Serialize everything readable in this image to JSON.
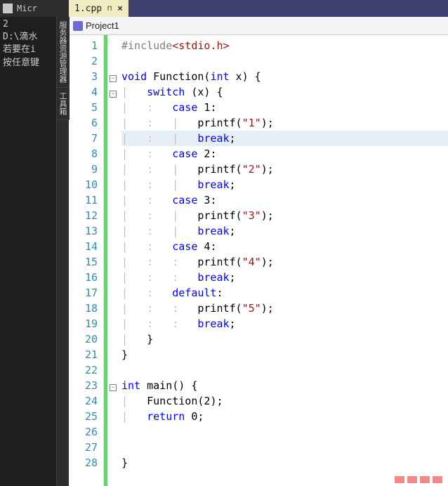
{
  "iconStrip": {
    "title": "Micr"
  },
  "tab": {
    "filename": "1.cpp",
    "close": "×"
  },
  "sidePanel": {
    "lines": [
      "2",
      "D:\\滴水",
      "若要在i",
      "按任意键"
    ],
    "vtabs": [
      "服务器资源管理器",
      "工具箱"
    ]
  },
  "scope": {
    "project": "Project1"
  },
  "code": {
    "lines": [
      {
        "n": 1,
        "fold": "",
        "tokens": [
          [
            "pre",
            "#include"
          ],
          [
            "inc",
            "<stdio.h>"
          ]
        ],
        "indent": 0
      },
      {
        "n": 2,
        "fold": "",
        "tokens": [],
        "indent": 0
      },
      {
        "n": 3,
        "fold": "-",
        "tokens": [
          [
            "kw",
            "void"
          ],
          [
            "ident",
            " Function("
          ],
          [
            "kw",
            "int"
          ],
          [
            "ident",
            " x) {"
          ]
        ],
        "indent": 0
      },
      {
        "n": 4,
        "fold": "-",
        "tokens": [
          [
            "g",
            "|   "
          ],
          [
            "ctrl",
            "switch"
          ],
          [
            "ident",
            " (x) {"
          ]
        ],
        "indent": 0
      },
      {
        "n": 5,
        "fold": "",
        "tokens": [
          [
            "g",
            "|   :   "
          ],
          [
            "ctrl",
            "case"
          ],
          [
            "ident",
            " "
          ],
          [
            "num",
            "1"
          ],
          [
            "ident",
            ":"
          ]
        ],
        "indent": 0
      },
      {
        "n": 6,
        "fold": "",
        "tokens": [
          [
            "g",
            "|   :   |   "
          ],
          [
            "ident",
            "printf("
          ],
          [
            "str",
            "\"1\""
          ],
          [
            "ident",
            ");"
          ]
        ],
        "indent": 0
      },
      {
        "n": 7,
        "fold": "",
        "hl": true,
        "tokens": [
          [
            "g",
            "|   :   |   "
          ],
          [
            "ctrl",
            "break"
          ],
          [
            "ident",
            ";"
          ]
        ],
        "indent": 0
      },
      {
        "n": 8,
        "fold": "",
        "tokens": [
          [
            "g",
            "|   :   "
          ],
          [
            "ctrl",
            "case"
          ],
          [
            "ident",
            " "
          ],
          [
            "num",
            "2"
          ],
          [
            "ident",
            ":"
          ]
        ],
        "indent": 0
      },
      {
        "n": 9,
        "fold": "",
        "tokens": [
          [
            "g",
            "|   :   |   "
          ],
          [
            "ident",
            "printf("
          ],
          [
            "str",
            "\"2\""
          ],
          [
            "ident",
            ");"
          ]
        ],
        "indent": 0
      },
      {
        "n": 10,
        "fold": "",
        "tokens": [
          [
            "g",
            "|   :   |   "
          ],
          [
            "ctrl",
            "break"
          ],
          [
            "ident",
            ";"
          ]
        ],
        "indent": 0
      },
      {
        "n": 11,
        "fold": "",
        "tokens": [
          [
            "g",
            "|   :   "
          ],
          [
            "ctrl",
            "case"
          ],
          [
            "ident",
            " "
          ],
          [
            "num",
            "3"
          ],
          [
            "ident",
            ":"
          ]
        ],
        "indent": 0
      },
      {
        "n": 12,
        "fold": "",
        "tokens": [
          [
            "g",
            "|   :   |   "
          ],
          [
            "ident",
            "printf("
          ],
          [
            "str",
            "\"3\""
          ],
          [
            "ident",
            ");"
          ]
        ],
        "indent": 0
      },
      {
        "n": 13,
        "fold": "",
        "tokens": [
          [
            "g",
            "|   :   |   "
          ],
          [
            "ctrl",
            "break"
          ],
          [
            "ident",
            ";"
          ]
        ],
        "indent": 0
      },
      {
        "n": 14,
        "fold": "",
        "tokens": [
          [
            "g",
            "|   :   "
          ],
          [
            "ctrl",
            "case"
          ],
          [
            "ident",
            " "
          ],
          [
            "num",
            "4"
          ],
          [
            "ident",
            ":"
          ]
        ],
        "indent": 0
      },
      {
        "n": 15,
        "fold": "",
        "tokens": [
          [
            "g",
            "|   :   :   "
          ],
          [
            "ident",
            "printf("
          ],
          [
            "str",
            "\"4\""
          ],
          [
            "ident",
            ");"
          ]
        ],
        "indent": 0
      },
      {
        "n": 16,
        "fold": "",
        "tokens": [
          [
            "g",
            "|   :   :   "
          ],
          [
            "ctrl",
            "break"
          ],
          [
            "ident",
            ";"
          ]
        ],
        "indent": 0
      },
      {
        "n": 17,
        "fold": "",
        "tokens": [
          [
            "g",
            "|   :   "
          ],
          [
            "ctrl",
            "default"
          ],
          [
            "ident",
            ":"
          ]
        ],
        "indent": 0
      },
      {
        "n": 18,
        "fold": "",
        "tokens": [
          [
            "g",
            "|   :   :   "
          ],
          [
            "ident",
            "printf("
          ],
          [
            "str",
            "\"5\""
          ],
          [
            "ident",
            ");"
          ]
        ],
        "indent": 0
      },
      {
        "n": 19,
        "fold": "",
        "tokens": [
          [
            "g",
            "|   :   :   "
          ],
          [
            "ctrl",
            "break"
          ],
          [
            "ident",
            ";"
          ]
        ],
        "indent": 0
      },
      {
        "n": 20,
        "fold": "",
        "tokens": [
          [
            "g",
            "|   "
          ],
          [
            "ident",
            "}"
          ]
        ],
        "indent": 0
      },
      {
        "n": 21,
        "fold": "",
        "tokens": [
          [
            "ident",
            "}"
          ]
        ],
        "indent": 0
      },
      {
        "n": 22,
        "fold": "",
        "tokens": [],
        "indent": 0
      },
      {
        "n": 23,
        "fold": "-",
        "tokens": [
          [
            "kw",
            "int"
          ],
          [
            "ident",
            " main() {"
          ]
        ],
        "indent": 0
      },
      {
        "n": 24,
        "fold": "",
        "tokens": [
          [
            "g",
            "|   "
          ],
          [
            "ident",
            "Function("
          ],
          [
            "num",
            "2"
          ],
          [
            "ident",
            ");"
          ]
        ],
        "indent": 0
      },
      {
        "n": 25,
        "fold": "",
        "tokens": [
          [
            "g",
            "|   "
          ],
          [
            "ctrl",
            "return"
          ],
          [
            "ident",
            " "
          ],
          [
            "num",
            "0"
          ],
          [
            "ident",
            ";"
          ]
        ],
        "indent": 0
      },
      {
        "n": 26,
        "fold": "",
        "tokens": [],
        "indent": 0
      },
      {
        "n": 27,
        "fold": "",
        "tokens": [],
        "indent": 0
      },
      {
        "n": 28,
        "fold": "",
        "tokens": [
          [
            "ident",
            "}"
          ]
        ],
        "indent": 0
      }
    ]
  }
}
